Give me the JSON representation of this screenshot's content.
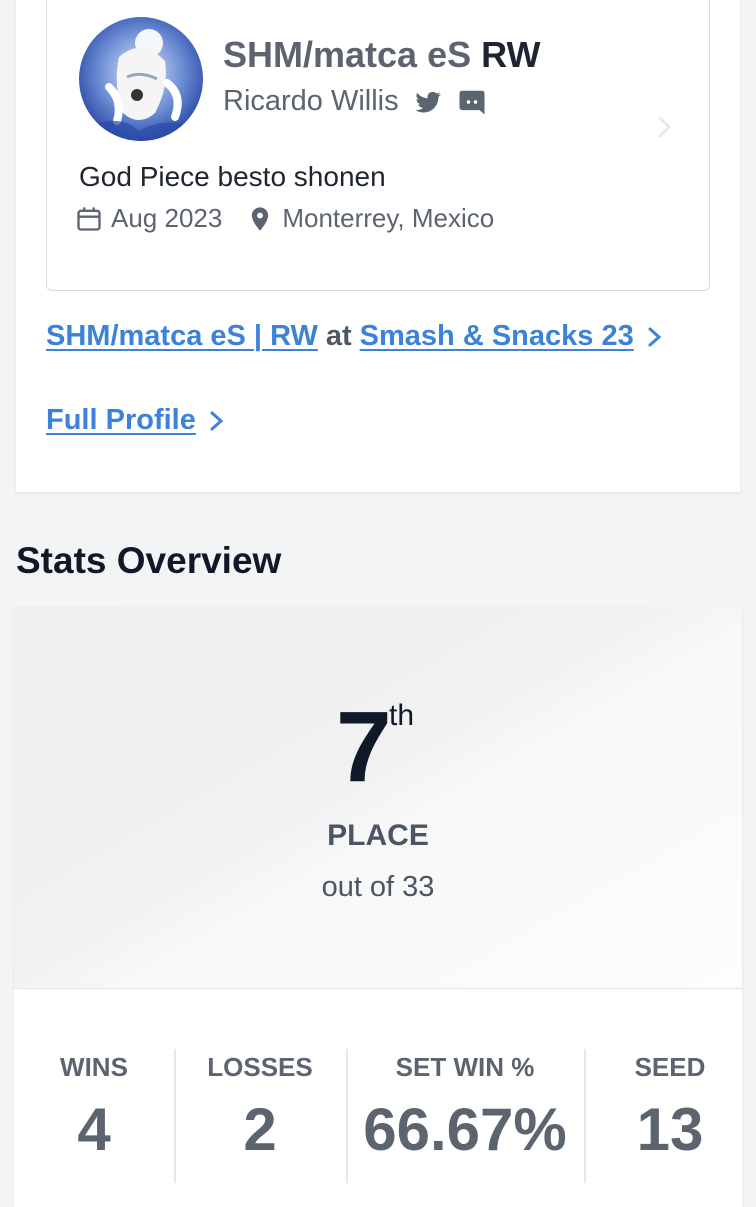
{
  "profile": {
    "sponsor_tag": "SHM/matca eS",
    "gamer_tag": "RW",
    "real_name": "Ricardo Willis",
    "bio": "God Piece besto shonen",
    "joined": "Aug 2023",
    "location": "Monterrey, Mexico"
  },
  "links": {
    "entrant_name": "SHM/matca eS | RW",
    "at": "at",
    "event_name": "Smash & Snacks 23",
    "full_profile": "Full Profile"
  },
  "stats": {
    "section_title": "Stats Overview",
    "place": "7",
    "place_suffix": "th",
    "place_label": "PLACE",
    "out_of": "out of 33",
    "items": [
      {
        "label": "WINS",
        "value": "4"
      },
      {
        "label": "LOSSES",
        "value": "2"
      },
      {
        "label": "SET WIN %",
        "value": "66.67%"
      },
      {
        "label": "SEED",
        "value": "13"
      }
    ]
  },
  "colors": {
    "link": "#3b82d8",
    "heading": "#111827",
    "muted": "#5c6470"
  },
  "icons": [
    "twitter-icon",
    "discord-icon",
    "calendar-icon",
    "location-pin-icon",
    "chevron-right-icon"
  ]
}
